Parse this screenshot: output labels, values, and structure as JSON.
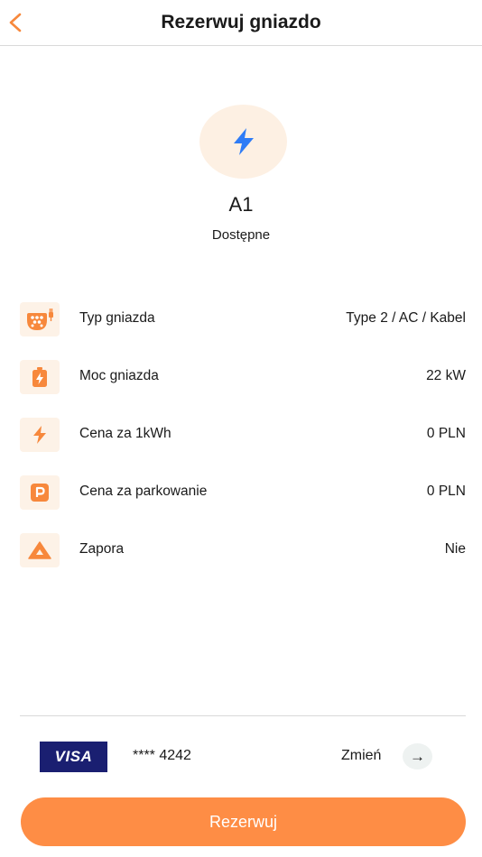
{
  "header": {
    "title": "Rezerwuj gniazdo",
    "back_icon": "chevron-left-icon"
  },
  "station": {
    "icon": "lightning-icon",
    "id": "A1",
    "status": "Dostępne"
  },
  "details": [
    {
      "icon": "connector-plug-icon",
      "label": "Typ gniazda",
      "value": "Type 2 / AC / Kabel"
    },
    {
      "icon": "battery-charge-icon",
      "label": "Moc gniazda",
      "value": "22 kW"
    },
    {
      "icon": "lightning-icon",
      "label": "Cena za 1kWh",
      "value": "0 PLN"
    },
    {
      "icon": "parking-icon",
      "label": "Cena za parkowanie",
      "value": "0 PLN"
    },
    {
      "icon": "barrier-triangle-icon",
      "label": "Zapora",
      "value": "Nie"
    }
  ],
  "payment": {
    "brand": "VISA",
    "card_number": "**** 4242",
    "change_label": "Zmień",
    "change_icon": "arrow-right-icon"
  },
  "cta": {
    "label": "Rezerwuj"
  },
  "colors": {
    "accent": "#fe8d45",
    "icon_orange": "#f7883c",
    "icon_bg": "#fdf2e7",
    "hero_bg": "#fdf0e3",
    "bolt_blue": "#2f7cf6",
    "visa_navy": "#1a1f71"
  }
}
